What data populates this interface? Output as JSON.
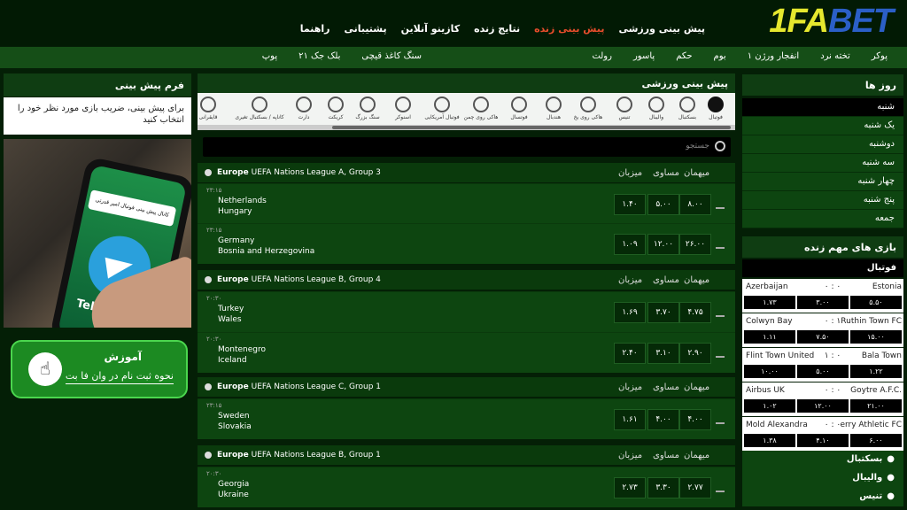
{
  "header": {
    "logo": "1FABET",
    "logo_part1": "1",
    "logo_part2": "FA",
    "logo_part3": "BET",
    "nav": [
      {
        "label": "پیش بینی ورزشی"
      },
      {
        "label": "پیش بینی زنده",
        "active": true
      },
      {
        "label": "نتایج زنده"
      },
      {
        "label": "کازینو آنلاین"
      },
      {
        "label": "پشتیبانی"
      },
      {
        "label": "راهنما"
      }
    ]
  },
  "subnav": {
    "row1": [
      "پوکر",
      "تخته نرد",
      "انفجار ورژن ۱",
      "بوم",
      "حکم",
      "پاسور",
      "رولت"
    ],
    "row2": [
      "سنگ کاغذ قیچی",
      "بلک جک ۲۱",
      "پوپ"
    ]
  },
  "left": {
    "form_title": "فرم پیش بینی",
    "form_note": "برای پیش بینی، ضریب بازی مورد نظر خود را انتخاب کنید",
    "promo": {
      "bubble": "کانال پیش بینی فوتبال امیر قدرتی",
      "label": "Telegram"
    },
    "edu": {
      "title": "آموزش",
      "subtitle": "نحوه ثبت نام در وان فا بت"
    }
  },
  "middle": {
    "title": "پیش بینی ورزشی",
    "sports": [
      "فوتبال",
      "بسکتبال",
      "والیبال",
      "تنیس",
      "هاکی روی یخ",
      "هندبال",
      "فوتسال",
      "هاکی روی چمن",
      "فوتبال آمریکایی",
      "اسنوکر",
      "سنگ بزرگ",
      "کریکت",
      "دارت",
      "کاناپه / بسکتبال تغیری",
      "قایقرانی"
    ],
    "search_placeholder": "جستجو",
    "columns": {
      "home": "میهمان",
      "draw": "مساوی",
      "away": "میزبان"
    },
    "leagues": [
      {
        "name_bold": "Europe",
        "name": "UEFA Nations League A, Group 3",
        "matches": [
          {
            "time": "۲۳:۱۵",
            "team1": "Netherlands",
            "team2": "Hungary",
            "odds": [
              "۸.۰۰",
              "۵.۰۰",
              "۱.۴۰"
            ]
          },
          {
            "time": "۲۳:۱۵",
            "team1": "Germany",
            "team2": "Bosnia and Herzegovina",
            "odds": [
              "۲۶.۰۰",
              "۱۲.۰۰",
              "۱.۰۹"
            ]
          }
        ]
      },
      {
        "name_bold": "Europe",
        "name": "UEFA Nations League B, Group 4",
        "matches": [
          {
            "time": "۲۰:۳۰",
            "team1": "Turkey",
            "team2": "Wales",
            "odds": [
              "۴.۷۵",
              "۳.۷۰",
              "۱.۶۹"
            ]
          },
          {
            "time": "۲۰:۳۰",
            "team1": "Montenegro",
            "team2": "Iceland",
            "odds": [
              "۲.۹۰",
              "۳.۱۰",
              "۲.۴۰"
            ]
          }
        ]
      },
      {
        "name_bold": "Europe",
        "name": "UEFA Nations League C, Group 1",
        "matches": [
          {
            "time": "۲۳:۱۵",
            "team1": "Sweden",
            "team2": "Slovakia",
            "odds": [
              "۴.۰۰",
              "۴.۰۰",
              "۱.۶۱"
            ]
          }
        ]
      },
      {
        "name_bold": "Europe",
        "name": "UEFA Nations League B, Group 1",
        "matches": [
          {
            "time": "۲۰:۳۰",
            "team1": "Georgia",
            "team2": "Ukraine",
            "odds": [
              "۲.۷۷",
              "۳.۳۰",
              "۲.۷۳"
            ]
          }
        ]
      }
    ]
  },
  "right": {
    "days_title": "روز ها",
    "days": [
      "شنبه",
      "یک شنبه",
      "دوشنبه",
      "سه شنبه",
      "چهار شنبه",
      "پنج شنبه",
      "جمعه"
    ],
    "live_title": "بازی های مهم زنده",
    "football": "فوتبال",
    "live": [
      {
        "left": "Azerbaijan",
        "right": "Estonia",
        "score": "۰ : ۰",
        "odds": [
          "۱.۷۳",
          "۳.۰۰",
          "۵.۵۰"
        ]
      },
      {
        "left": "Colwyn Bay",
        "right": "Ruthin Town FC",
        "score": "۰ : ۱",
        "odds": [
          "۱.۱۱",
          "۷.۵۰",
          "۱۵.۰۰"
        ]
      },
      {
        "left": "Flint Town United",
        "right": "Bala Town",
        "score": "۱ : ۰",
        "odds": [
          "۱۰.۰۰",
          "۵.۰۰",
          "۱.۲۲"
        ]
      },
      {
        "left": "Airbus UK",
        "right": "Goytre A.F.C.",
        "score": "۰ : ۰",
        "odds": [
          "۱.۰۲",
          "۱۲.۰۰",
          "۲۱.۰۰"
        ]
      },
      {
        "left": "Mold Alexandra",
        "right": "erry Athletic FC",
        "score": "۰ : ۰",
        "odds": [
          "۱.۳۸",
          "۴.۱۰",
          "۶.۰۰"
        ]
      }
    ],
    "categories": [
      "بسکتبال",
      "والیبال",
      "تنیس"
    ]
  }
}
